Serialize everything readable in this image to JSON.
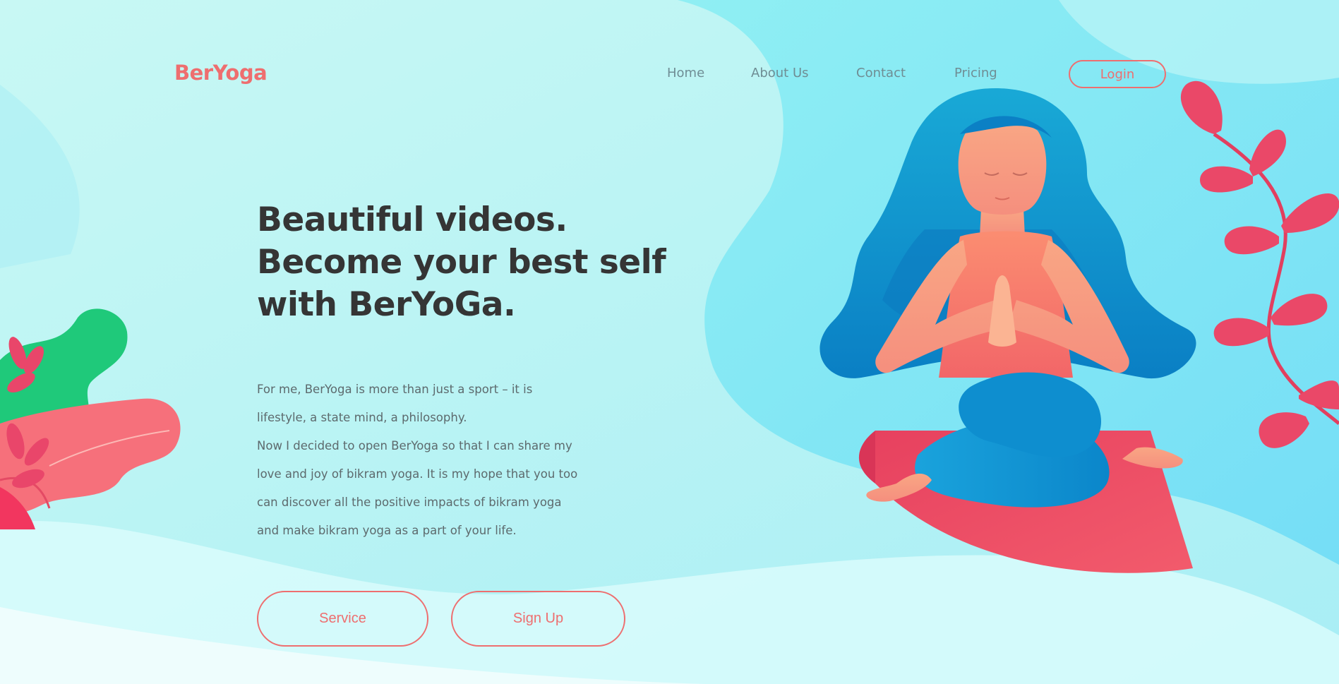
{
  "brand": {
    "name": "BerYoga"
  },
  "nav": {
    "items": [
      {
        "label": "Home"
      },
      {
        "label": "About Us"
      },
      {
        "label": "Contact"
      },
      {
        "label": "Pricing"
      }
    ],
    "login_label": "Login"
  },
  "hero": {
    "title_lines": [
      "Beautiful videos.",
      "Become your best self",
      "with BerYoGa."
    ],
    "body_lines": [
      "For me, BerYoga is more than just a sport – it is",
      "lifestyle, a state mind, a philosophy.",
      "Now I decided to open BerYoga so that I can share my",
      "love and joy of bikram yoga. It is my hope that you too",
      "can discover all the positive impacts of bikram yoga",
      "and make bikram yoga as a part of your life."
    ],
    "service_label": "Service",
    "signup_label": "Sign Up"
  },
  "colors": {
    "accent": "#ee6e6f",
    "title": "#353535",
    "nav": "#6f8d94",
    "background": "#bff5f5"
  },
  "illustrations": [
    "meditating-woman-illustration",
    "leaf-branch-icon",
    "plant-cluster-icon"
  ]
}
